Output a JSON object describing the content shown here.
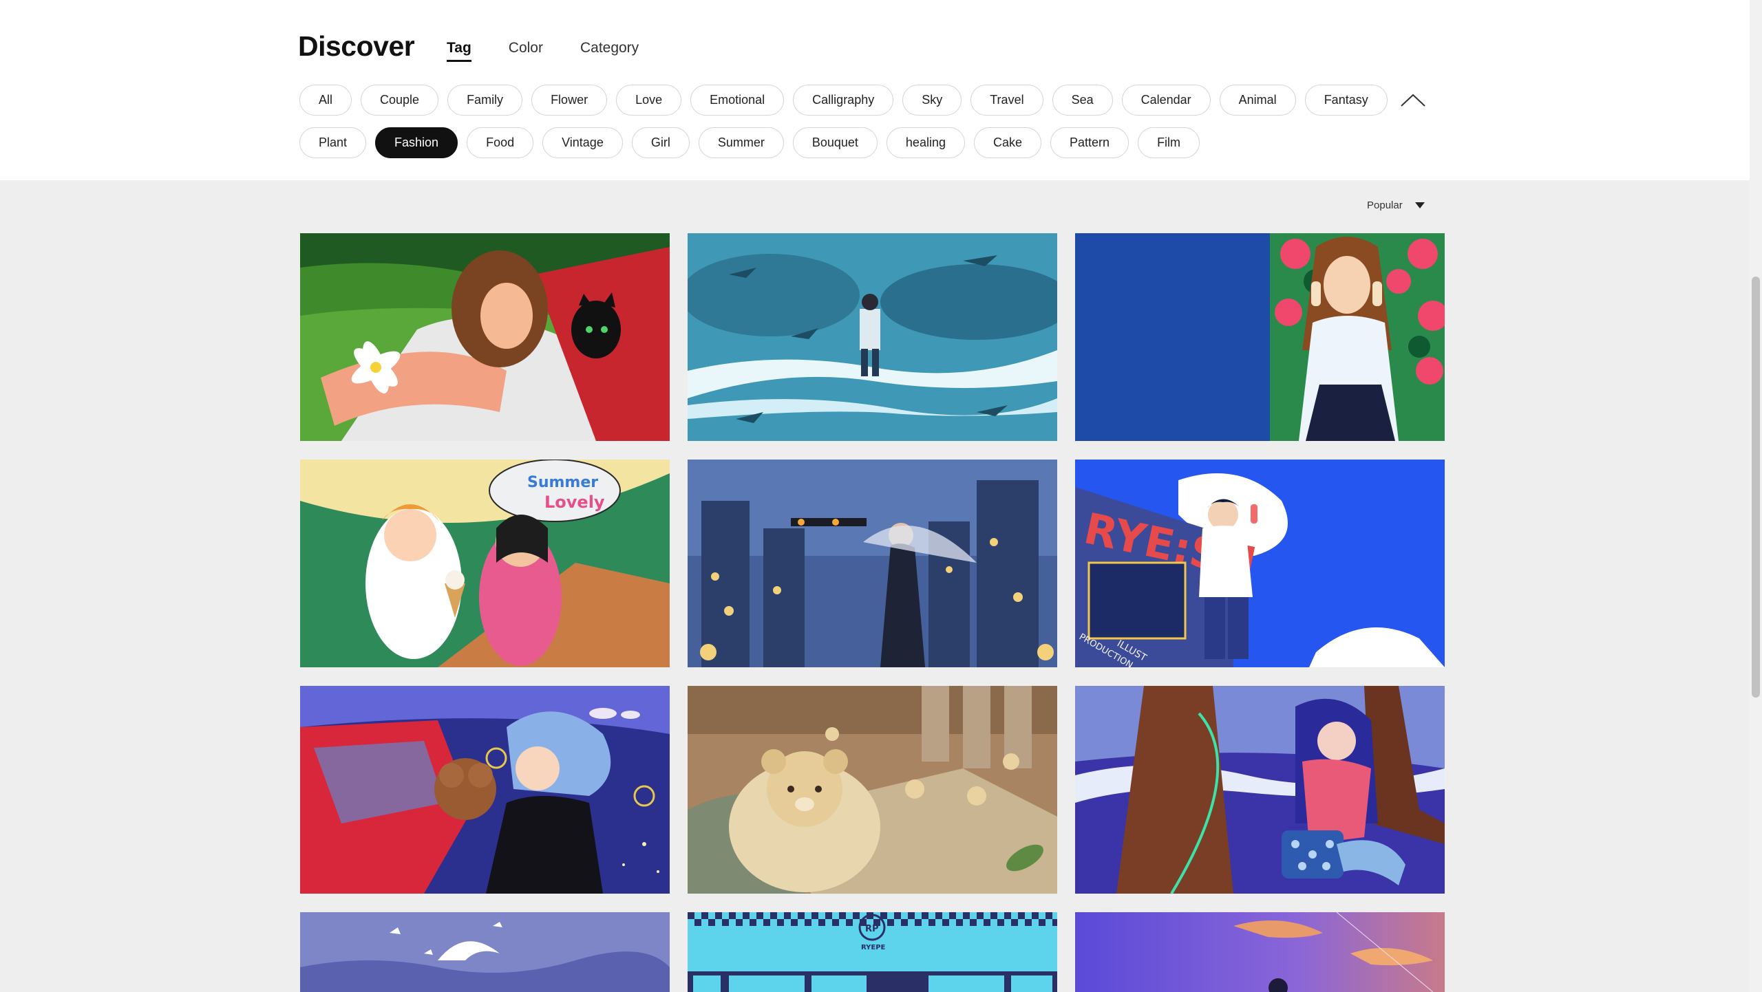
{
  "header": {
    "title": "Discover",
    "tabs": [
      {
        "label": "Tag",
        "active": true
      },
      {
        "label": "Color",
        "active": false
      },
      {
        "label": "Category",
        "active": false
      }
    ]
  },
  "tags_row1": [
    "All",
    "Couple",
    "Family",
    "Flower",
    "Love",
    "Emotional",
    "Calligraphy",
    "Sky",
    "Travel",
    "Sea",
    "Calendar",
    "Animal",
    "Fantasy"
  ],
  "tags_row2": [
    "Plant",
    "Fashion",
    "Food",
    "Vintage",
    "Girl",
    "Summer",
    "Bouquet",
    "healing",
    "Cake",
    "Pattern",
    "Film"
  ],
  "selected_tag": "Fashion",
  "collapse_icon": "chevron-up-icon",
  "sort": {
    "label": "Popular",
    "icon": "caret-down-icon"
  },
  "gallery": {
    "r1c3_sign": "",
    "r2c1_sign_line1": "Summer",
    "r2c1_sign_line2": "Lovely",
    "r2c3_sign": "RYE:SN",
    "r2c3_small1": "ILLUST",
    "r2c3_small2": "PRODUCTION",
    "r4c2_logo": "RYEPE",
    "r4c2_logo_badge": "RP"
  },
  "colors": {
    "accent": "#111111",
    "tag_border": "#d6d6d6",
    "page_bg": "#eeeeee"
  }
}
